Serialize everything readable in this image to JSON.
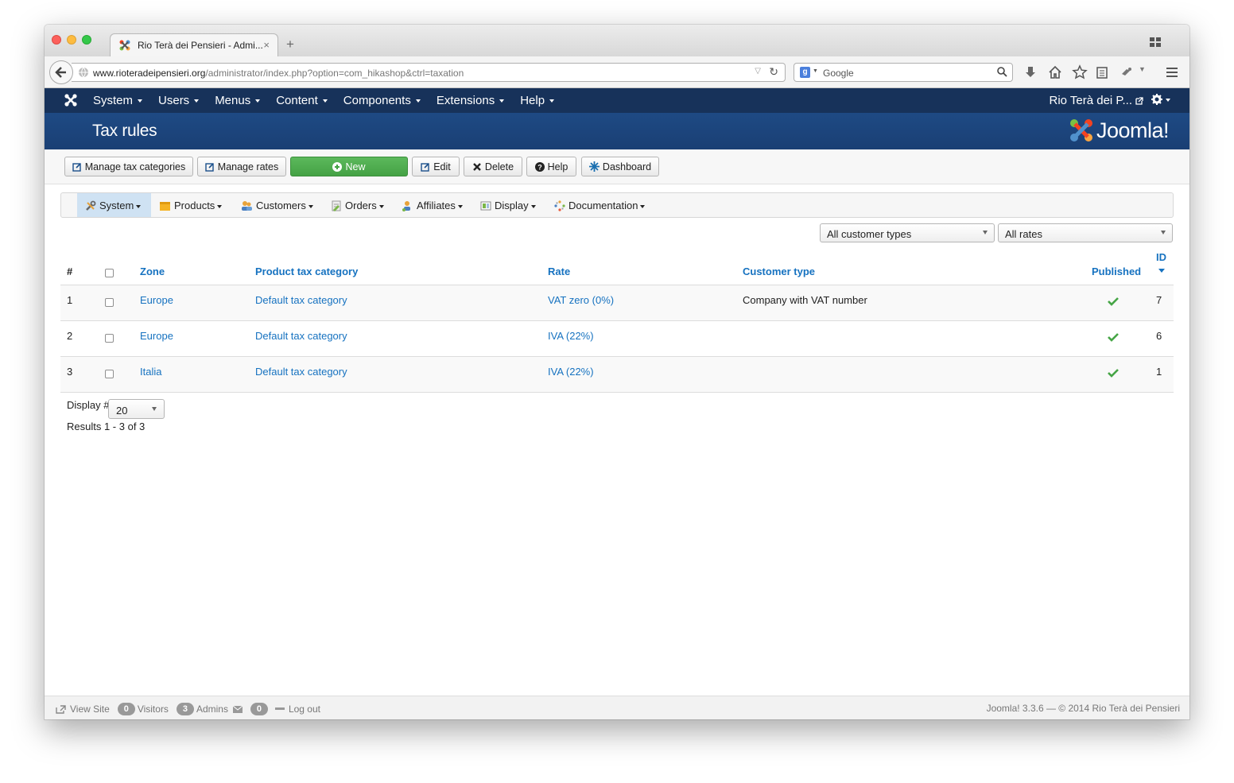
{
  "browser": {
    "tab_title": "Rio Terà dei Pensieri - Admi...",
    "url_domain": "www.rioteradeipensieri.org",
    "url_path": "/administrator/index.php?option=com_hikashop&ctrl=taxation",
    "search_placeholder": "Google"
  },
  "top_nav": {
    "items": [
      "System",
      "Users",
      "Menus",
      "Content",
      "Components",
      "Extensions",
      "Help"
    ],
    "site_name": "Rio Terà dei P..."
  },
  "header": {
    "title": "Tax rules",
    "logo_text": "Joomla!"
  },
  "toolbar": {
    "manage_tax_categories": "Manage tax categories",
    "manage_rates": "Manage rates",
    "new": "New",
    "edit": "Edit",
    "delete": "Delete",
    "help": "Help",
    "dashboard": "Dashboard"
  },
  "submenu": {
    "system": "System",
    "products": "Products",
    "customers": "Customers",
    "orders": "Orders",
    "affiliates": "Affiliates",
    "display": "Display",
    "documentation": "Documentation"
  },
  "filters": {
    "customer_types": "All customer types",
    "rates": "All rates"
  },
  "table": {
    "headers": {
      "num": "#",
      "zone": "Zone",
      "product_tax_category": "Product tax category",
      "rate": "Rate",
      "customer_type": "Customer type",
      "published": "Published",
      "id": "ID"
    },
    "rows": [
      {
        "num": "1",
        "zone": "Europe",
        "category": "Default tax category",
        "rate": "VAT zero (0%)",
        "customer_type": "Company with VAT number",
        "published": true,
        "id": "7"
      },
      {
        "num": "2",
        "zone": "Europe",
        "category": "Default tax category",
        "rate": "IVA (22%)",
        "customer_type": "",
        "published": true,
        "id": "6"
      },
      {
        "num": "3",
        "zone": "Italia",
        "category": "Default tax category",
        "rate": "IVA (22%)",
        "customer_type": "",
        "published": true,
        "id": "1"
      }
    ]
  },
  "pagination": {
    "display_label": "Display #",
    "display_value": "20",
    "results": "Results 1 - 3 of 3"
  },
  "footer": {
    "view_site": "View Site",
    "visitors_count": "0",
    "visitors_label": "Visitors",
    "admins_count": "3",
    "admins_label": "Admins",
    "messages_count": "0",
    "logout": "Log out",
    "version": "Joomla! 3.3.6  —  © 2014 Rio Terà dei Pensieri"
  },
  "colors": {
    "nav_bg": "#17325a",
    "header_bg": "#1e4a84",
    "link": "#1672c0",
    "new_button": "#4fae4f",
    "published_check": "#46a546"
  }
}
